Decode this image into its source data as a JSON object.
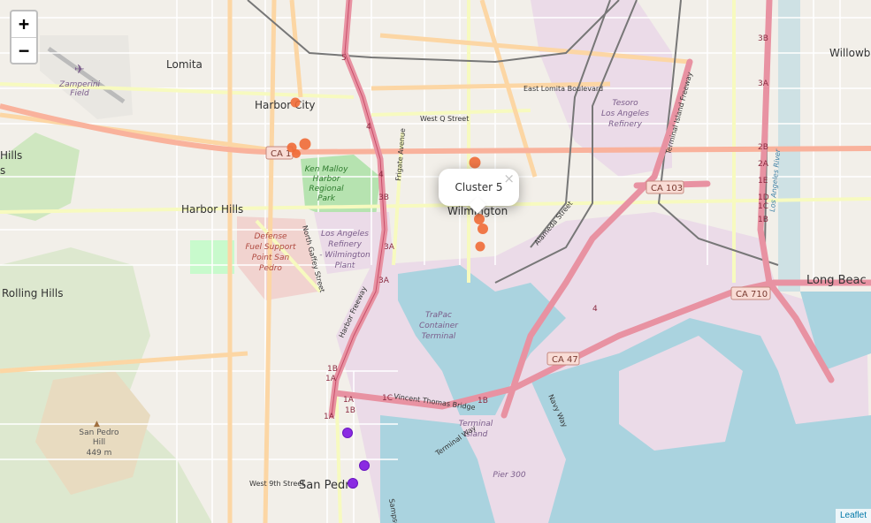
{
  "map": {
    "zoom_in_label": "+",
    "zoom_out_label": "−",
    "attribution": "Leaflet",
    "popup": {
      "text": "Cluster 5",
      "close_label": "×"
    },
    "colors": {
      "cluster_orange": "#f06a36",
      "cluster_purple": "#8a2be2",
      "water": "#aad3df",
      "industrial": "#ebdbe8",
      "motorway": "#e892a2",
      "trunk": "#f9b29c",
      "park": "#c8facc"
    }
  },
  "labels": {
    "lomita": "Lomita",
    "harbor_city": "Harbor City",
    "harbor_hills": "Harbor Hills",
    "rolling_hills": "Rolling Hills",
    "wilmington": "Wilmington",
    "long_beach": "Long Beac",
    "willowbrook": "Willowb",
    "hills_edge": "Hills",
    "s_edge": "s",
    "san_pedro": "San Pedro",
    "zamperini_1": "Zamperini",
    "zamperini_2": "Field",
    "ken_malloy_1": "Ken Malloy",
    "ken_malloy_2": "Harbor",
    "ken_malloy_3": "Regional",
    "ken_malloy_4": "Park",
    "defense_1": "Defense",
    "defense_2": "Fuel Support",
    "defense_3": "Point San",
    "defense_4": "Pedro",
    "refinery_1": "Los Angeles",
    "refinery_2": "Refinery",
    "refinery_3": "- Wilmington",
    "refinery_4": "Plant",
    "tesoro_1": "Tesoro",
    "tesoro_2": "Los Angeles",
    "tesoro_3": "Refinery",
    "trapac_1": "TraPac",
    "trapac_2": "Container",
    "trapac_3": "Terminal",
    "terminal_island_1": "Terminal",
    "terminal_island_2": "Island",
    "pier_300": "Pier 300",
    "sp_hill_1": "San Pedro",
    "sp_hill_2": "Hill",
    "sp_hill_3": "449 m",
    "east_lomita_blvd": "East Lomita Boulevard",
    "west_q_st": "West Q Street",
    "west_9th_st": "West 9th Street",
    "frigate_ave": "Frigate Avenue",
    "north_gaffey": "North Gaffey Street",
    "harbor_fwy": "Harbor Freeway",
    "alameda_st": "Alameda Street",
    "terminal_island_fwy": "Terminal Island Freeway",
    "vincent_thomas_bridge": "Vincent Thomas Bridge",
    "terminal_way": "Terminal Way",
    "navy_way": "Navy Way",
    "la_river": "Los Angeles River",
    "sampson": "Sampson",
    "ca1": "CA 1",
    "ca103": "CA 103",
    "ca710": "CA 710",
    "ca47": "CA 47",
    "exits": {
      "e5": "5",
      "e4": "4",
      "e3b": "3B",
      "e3a": "3A",
      "e3a_2": "3A",
      "e1b": "1B",
      "e1a": "1A",
      "e1a_2": "1A",
      "e1b_2": "1B",
      "e1c": "1C",
      "e1b_3": "1B",
      "r3b": "3B",
      "r3a": "3A",
      "r2b": "2B",
      "r2a": "2A",
      "r1e": "1E",
      "r1d": "1D",
      "r1c": "1C",
      "r1b": "1B",
      "e4_2": "4"
    }
  }
}
